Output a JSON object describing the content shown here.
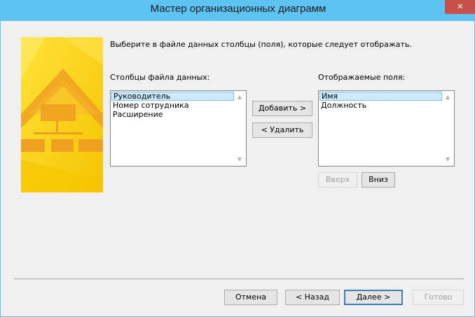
{
  "window": {
    "title": "Мастер организационных диаграмм",
    "close_label": "✕"
  },
  "prompt": "Выберите в файле данных столбцы (поля), которые следует отображать.",
  "available": {
    "label": "Столбцы файла данных:",
    "items": [
      "Руководитель",
      "Номер сотрудника",
      "Расширение"
    ]
  },
  "displayed": {
    "label": "Отображаемые поля:",
    "items": [
      "Имя",
      "Должность"
    ]
  },
  "buttons": {
    "add": "Добавить >",
    "remove": "< Удалить",
    "up": "Вверх",
    "down": "Вниз",
    "cancel": "Отмена",
    "back": "< Назад",
    "next": "Далее >",
    "finish": "Готово"
  },
  "colors": {
    "titlebar": "#5cc3f2",
    "close": "#c7514a",
    "banner_yellow": "#ffd21a"
  }
}
